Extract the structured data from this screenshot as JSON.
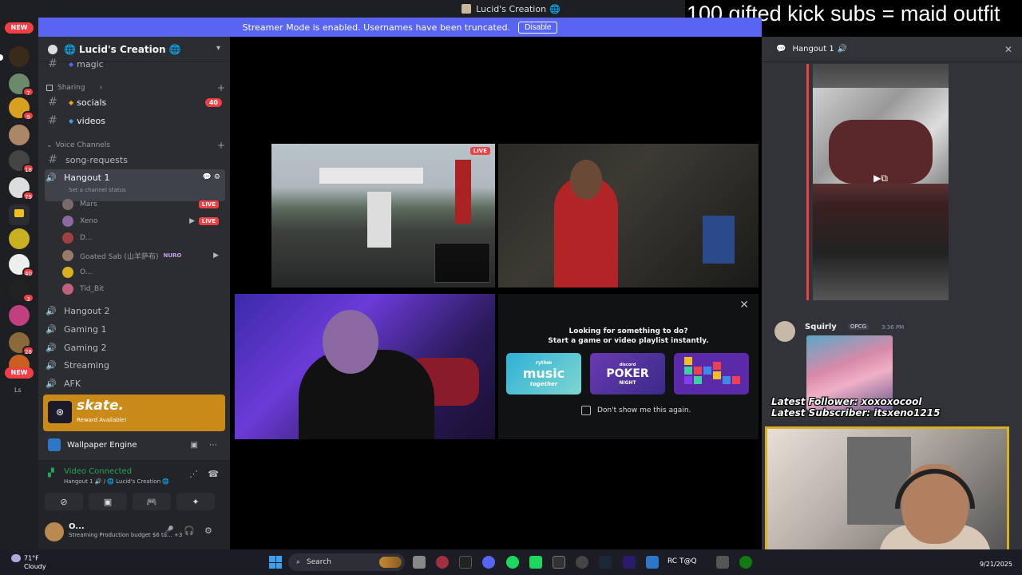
{
  "window": {
    "title": "Lucid's Creation",
    "banner_text": "Streamer Mode is enabled. Usernames have been truncated.",
    "banner_button": "Disable"
  },
  "stream_overlay": {
    "top_text": "100 gifted kick subs = maid outfit",
    "latest_follower": "Latest Follower: xoxoxocool",
    "latest_subscriber": "Latest Subscriber: itsxeno1215"
  },
  "server_rail": {
    "new_badge_top": "NEW",
    "new_badge_bottom": "NEW",
    "badges": [
      "7",
      "9",
      "18",
      "79",
      "40",
      "3",
      "26"
    ],
    "bottom_label": "Ls"
  },
  "server": {
    "name": "Lucid's Creation",
    "channels_top": [
      {
        "name": "magic"
      },
      {
        "name": "socials",
        "mentions": "40"
      },
      {
        "name": "videos"
      }
    ],
    "category_sharing": "Sharing",
    "category_voice": "Voice Channels",
    "song_requests": "song-requests",
    "hangout1": {
      "name": "Hangout 1",
      "status": "Set a channel status"
    },
    "voice_users": [
      {
        "name": "Mars",
        "live": "LIVE",
        "color": "#7a6a6a"
      },
      {
        "name": "Xeno",
        "live": "LIVE",
        "color": "#8a6aa0"
      },
      {
        "name": "D...",
        "color": "#a04040"
      },
      {
        "name": "Goated Sab (山羊萨布)",
        "tag": "NURO",
        "color": "#9a7a6a"
      },
      {
        "name": "O...",
        "color": "#d8b020"
      },
      {
        "name": "Tid_Bit",
        "color": "#c06080"
      }
    ],
    "voice_channels": [
      "Hangout 2",
      "Gaming 1",
      "Gaming 2",
      "Streaming",
      "AFK"
    ]
  },
  "promo": {
    "title": "skate.",
    "subtitle": "Reward Available!"
  },
  "activity_bar": {
    "label": "Wallpaper Engine"
  },
  "voice_status": {
    "connected": "Video Connected",
    "location": "Hangout 1 🔊 / 🌐 Lucid's Creation 🌐"
  },
  "user_panel": {
    "name": "O...",
    "status": "Streaming Production budget $6 ta...",
    "extra": "+3"
  },
  "activity_panel": {
    "line1": "Looking for something to do?",
    "line2": "Start a game or video playlist instantly.",
    "card_music": {
      "top": "rythm",
      "main": "music",
      "bottom": "together"
    },
    "card_poker": {
      "top": "discord",
      "main": "POKER",
      "bottom": "NIGHT"
    },
    "dont_show": "Don't show me this again."
  },
  "tiles": {
    "live_label": "LIVE"
  },
  "chat": {
    "channel": "Hangout 1",
    "message": {
      "author": "Squirly",
      "tag": "OPCG",
      "time": "3:36 PM"
    }
  },
  "taskbar": {
    "temp": "71°F",
    "condition": "Cloudy",
    "search": "Search",
    "tray_text": "RC T@Q",
    "date": "9/21/2025"
  }
}
